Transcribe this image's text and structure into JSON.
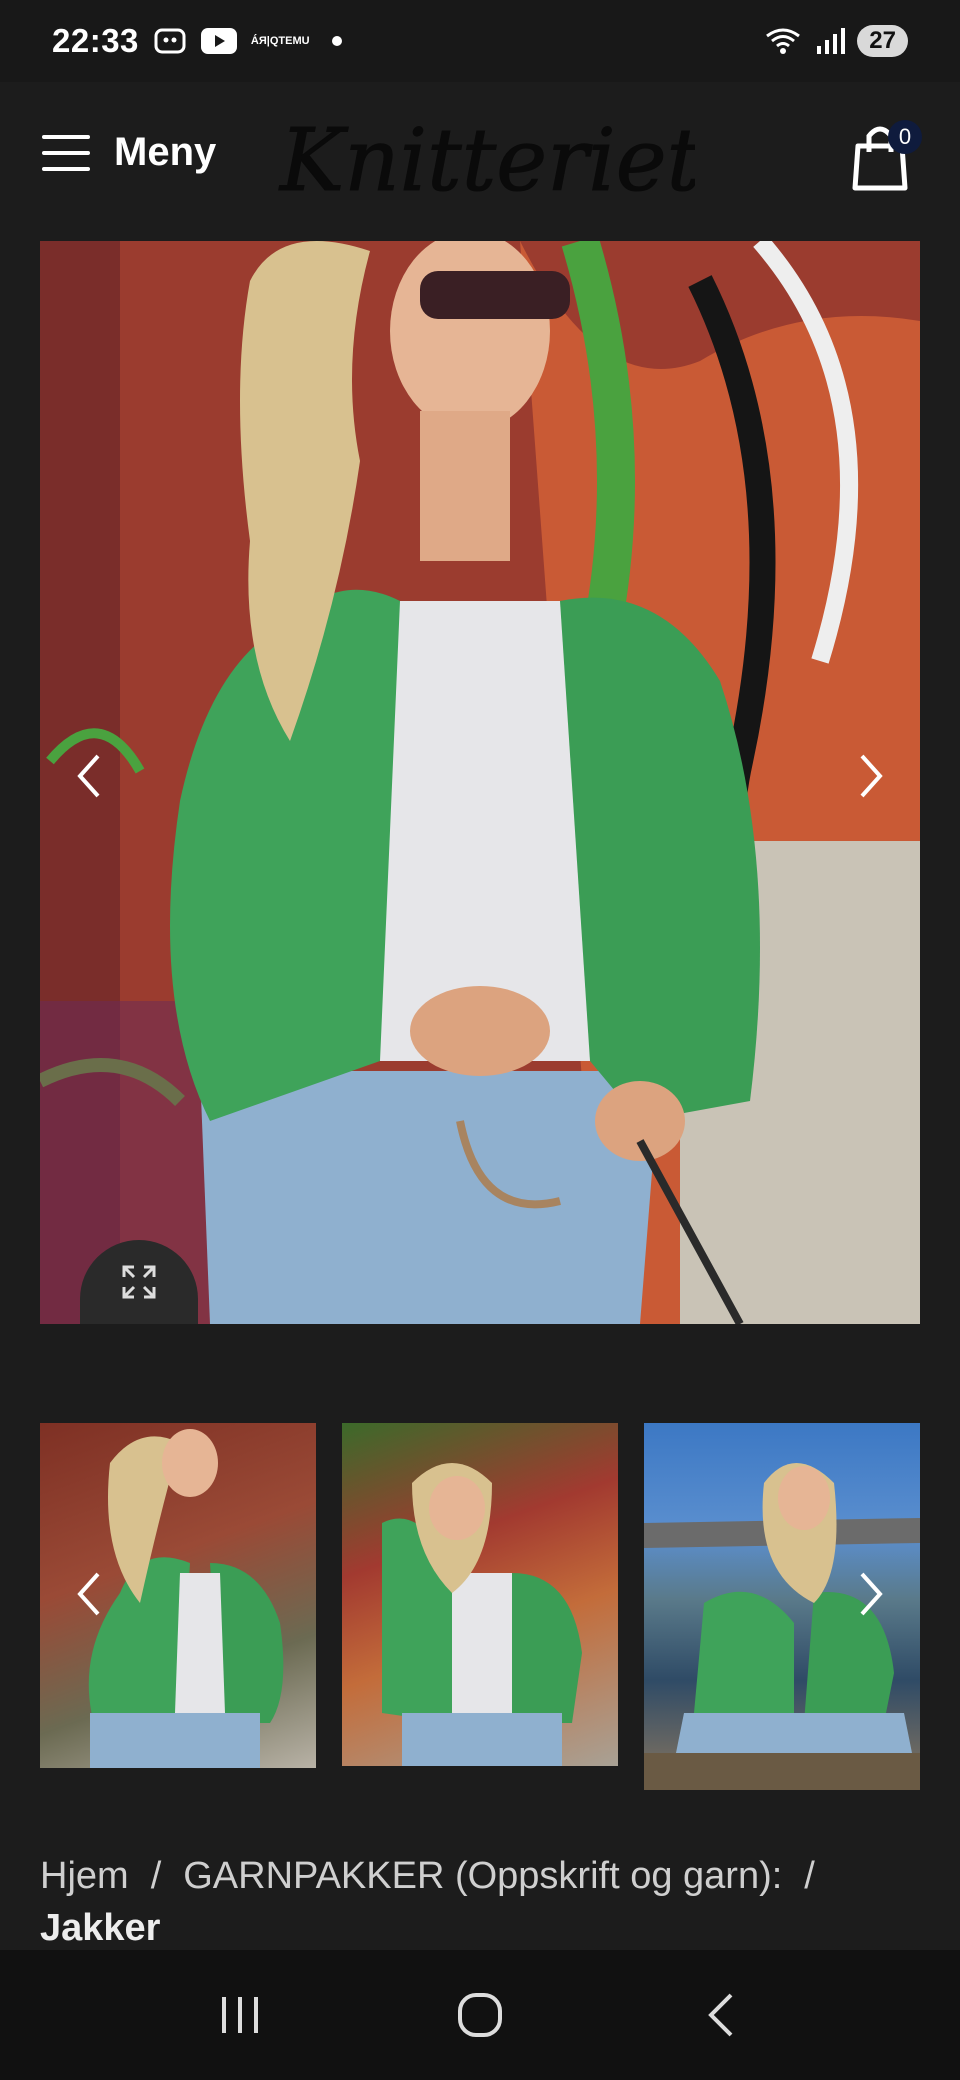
{
  "status_bar": {
    "time": "22:33",
    "notification_icons": [
      "screenshot-icon",
      "youtube-icon",
      "temu-icon"
    ],
    "temu_label_top": "ÁЯ|Q",
    "temu_label_bottom": "TEMU",
    "battery": "27"
  },
  "header": {
    "menu_label": "Meny",
    "logo_text": "Knitteriet",
    "cart_count": "0"
  },
  "gallery": {
    "main_image_alt": "Woman in green knitted cardigan in front of graffiti wall",
    "thumbnails": [
      {
        "alt": "Green cardigan front view"
      },
      {
        "alt": "Green cardigan pose"
      },
      {
        "alt": "Green cardigan by the water"
      }
    ]
  },
  "breadcrumb": {
    "home": "Hjem",
    "category": "GARNPAKKER (Oppskrift og garn):",
    "current": "Jakker"
  },
  "colors": {
    "background": "#1c1c1c",
    "badge": "#0f1b3d",
    "cardigan_green": "#3fa35a"
  }
}
